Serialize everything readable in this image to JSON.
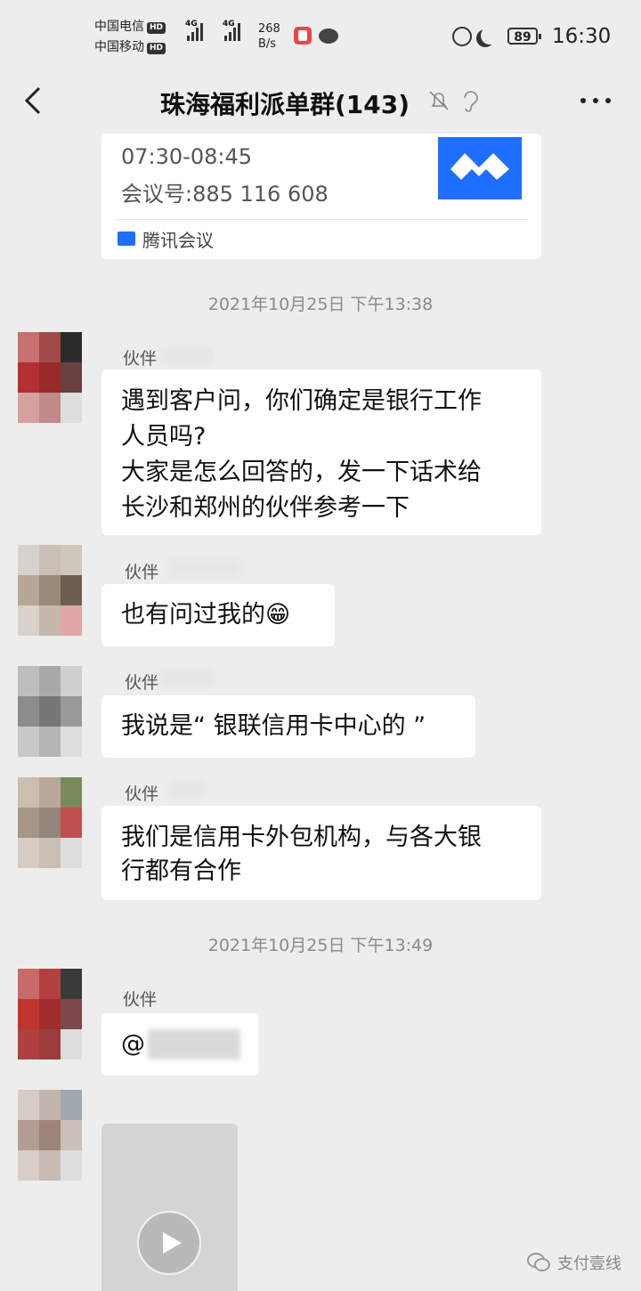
{
  "status_bar": {
    "carrier1": "中国电信",
    "carrier2": "中国移动",
    "hd": "HD",
    "net1": "4G",
    "net2": "4G",
    "speed_value": "268",
    "speed_unit": "B/s",
    "battery": "89",
    "time": "16:30"
  },
  "header": {
    "title": "珠海福利派单群(143)"
  },
  "meeting_card": {
    "time": "07:30-08:45",
    "meeting_id": "会议号:885 116 608",
    "app_name": "腾讯会议"
  },
  "messages": [
    {
      "timestamp": "2021年10月25日 下午13:38"
    },
    {
      "sender": "伙伴",
      "lines": [
        "遇到客户问，你们确定是银行工作",
        "人员吗?",
        "大家是怎么回答的，发一下话术给",
        "长沙和郑州的伙伴参考一下"
      ]
    },
    {
      "sender": "伙伴",
      "text": "也有问过我的😁"
    },
    {
      "sender": "伙伴",
      "text": "我说是“ 银联信用卡中心的 ”"
    },
    {
      "sender": "伙伴",
      "lines": [
        "我们是信用卡外包机构，与各大银",
        "行都有合作"
      ]
    },
    {
      "timestamp": "2021年10月25日 下午13:49"
    },
    {
      "sender": "伙伴",
      "text": "@"
    }
  ],
  "watermark": "支付壹线",
  "colors": {
    "background": "#ededed",
    "bubble": "#ffffff",
    "tencent_blue": "#1e6fff"
  }
}
